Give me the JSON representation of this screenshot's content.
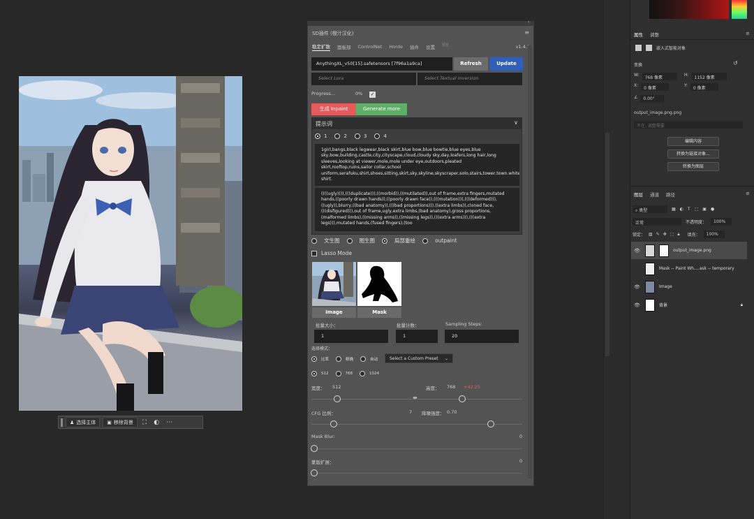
{
  "canvas": {
    "context_bar": {
      "select_subject": "选择主体",
      "remove_bg": "移除背景"
    }
  },
  "plugin": {
    "title": "SD插件 (橙汁汉化)",
    "tabs": [
      "稳定扩散",
      "面板部",
      "ControlNet",
      "Horde",
      "插件",
      "设置"
    ],
    "tab_extra": "预览",
    "version": "v1.4.1",
    "model": "AnythingXL_v50[15].safetensors [7f96a1a9ca]",
    "refresh_label": "Refresh",
    "update_label": "Update",
    "lora_placeholder": "Select Lora",
    "ti_placeholder": "Select Textual Inversion",
    "progress_label": "Progress...",
    "progress_value": "0%",
    "inpaint_label": "生成 Inpaint",
    "generate_more_label": "Generate more",
    "prompt_header": "提示词",
    "prompt_tabs": [
      "1",
      "2",
      "3",
      "4"
    ],
    "positive_prompt": "1girl,bangs,black legwear,black skirt,blue bow,blue bowtie,blue eyes,blue sky,bow,building,castle,city,cityscape,cloud,cloudy sky,day,loafers,long hair,long sleeves,looking at viewer,mole,mole under eye,outdoors,pleated skirt,rooftop,ruins,sailor collar,school uniform,serafuku,shirt,shoes,sitting,skirt,sky,skyline,skyscraper,solo,stairs,tower,town.white shirt.",
    "negative_prompt": "((((ugly)))),(((duplicate))),((morbid)),((mutilated)),out of frame,extra fingers,mutated hands,((poorly drawn hands)),((poorly drawn face)),(((mutation))),(((deformed))),((ugly)),blurry,((bad anatomy)),(((bad proportions))),((extra limbs)),cloned face,(((disfigured))),out of frame,ugly,extra limbs,(bad anatomy),gross proportions,(malformed limbs),((missing arms)),((missing legs)),(((extra arms))),(((extra legs))),mutated hands,(fused fingers),(too",
    "modes": [
      "文生图",
      "图生图",
      "局部重绘",
      "outpaint"
    ],
    "lasso_label": "Lasso Mode",
    "image_label": "Image",
    "mask_label": "Mask",
    "batch_size_label": "批量大小：",
    "batch_size_value": "1",
    "batch_count_label": "批量计数：",
    "batch_count_value": "1",
    "steps_label": "Sampling Steps:",
    "steps_value": "20",
    "select_mode_label": "选择模式：",
    "ratio_options": [
      "比率",
      "精确",
      "自动"
    ],
    "preset_placeholder": "Select a Custom Preset",
    "size_options": [
      "512",
      "768",
      "1024"
    ],
    "width_label": "宽度：",
    "width_value": "512",
    "height_label": "高度：",
    "height_value": "768",
    "height_extra": "+42.25",
    "cfg_label": "CFG 比例：",
    "cfg_value": "7",
    "denoise_label": "降噪强度：",
    "denoise_value": "0.70",
    "mask_blur_label": "Mask Blur:",
    "mask_blur_value": "0",
    "mask_expand_label": "蒙版扩展：",
    "mask_expand_value": "0"
  },
  "ps": {
    "properties_tabs": [
      "属性",
      "调整"
    ],
    "embedded_label": "嵌入式智能对象",
    "transform_label": "变换",
    "w_label": "W:",
    "w_value": "768 像素",
    "h_label": "H:",
    "h_value": "1152 像素",
    "x_label": "X:",
    "x_value": "0 像素",
    "y_label": "Y:",
    "y_value": "0 像素",
    "angle_value": "0.00°",
    "filename": "output_image.png.png",
    "unembed_placeholder": "不在..调整需要",
    "btn_edit": "编辑内容",
    "btn_convert_layer": "转换为链接对象...",
    "btn_convert_layers": "转换为图层",
    "layers_tabs": [
      "图层",
      "通道",
      "路径"
    ],
    "kind_label": "类型",
    "blend_mode": "正常",
    "opacity_label": "不透明度：",
    "opacity_value": "100%",
    "lock_label": "锁定：",
    "fill_label": "填充：",
    "fill_value": "100%",
    "layers": [
      {
        "name": "output_image.png",
        "visible": true,
        "selected": true
      },
      {
        "name": "Mask -- Paint Wh....ask -- temporary",
        "visible": false,
        "selected": false
      },
      {
        "name": "Image",
        "visible": true,
        "selected": false
      },
      {
        "name": "背景",
        "visible": true,
        "selected": false
      }
    ]
  }
}
